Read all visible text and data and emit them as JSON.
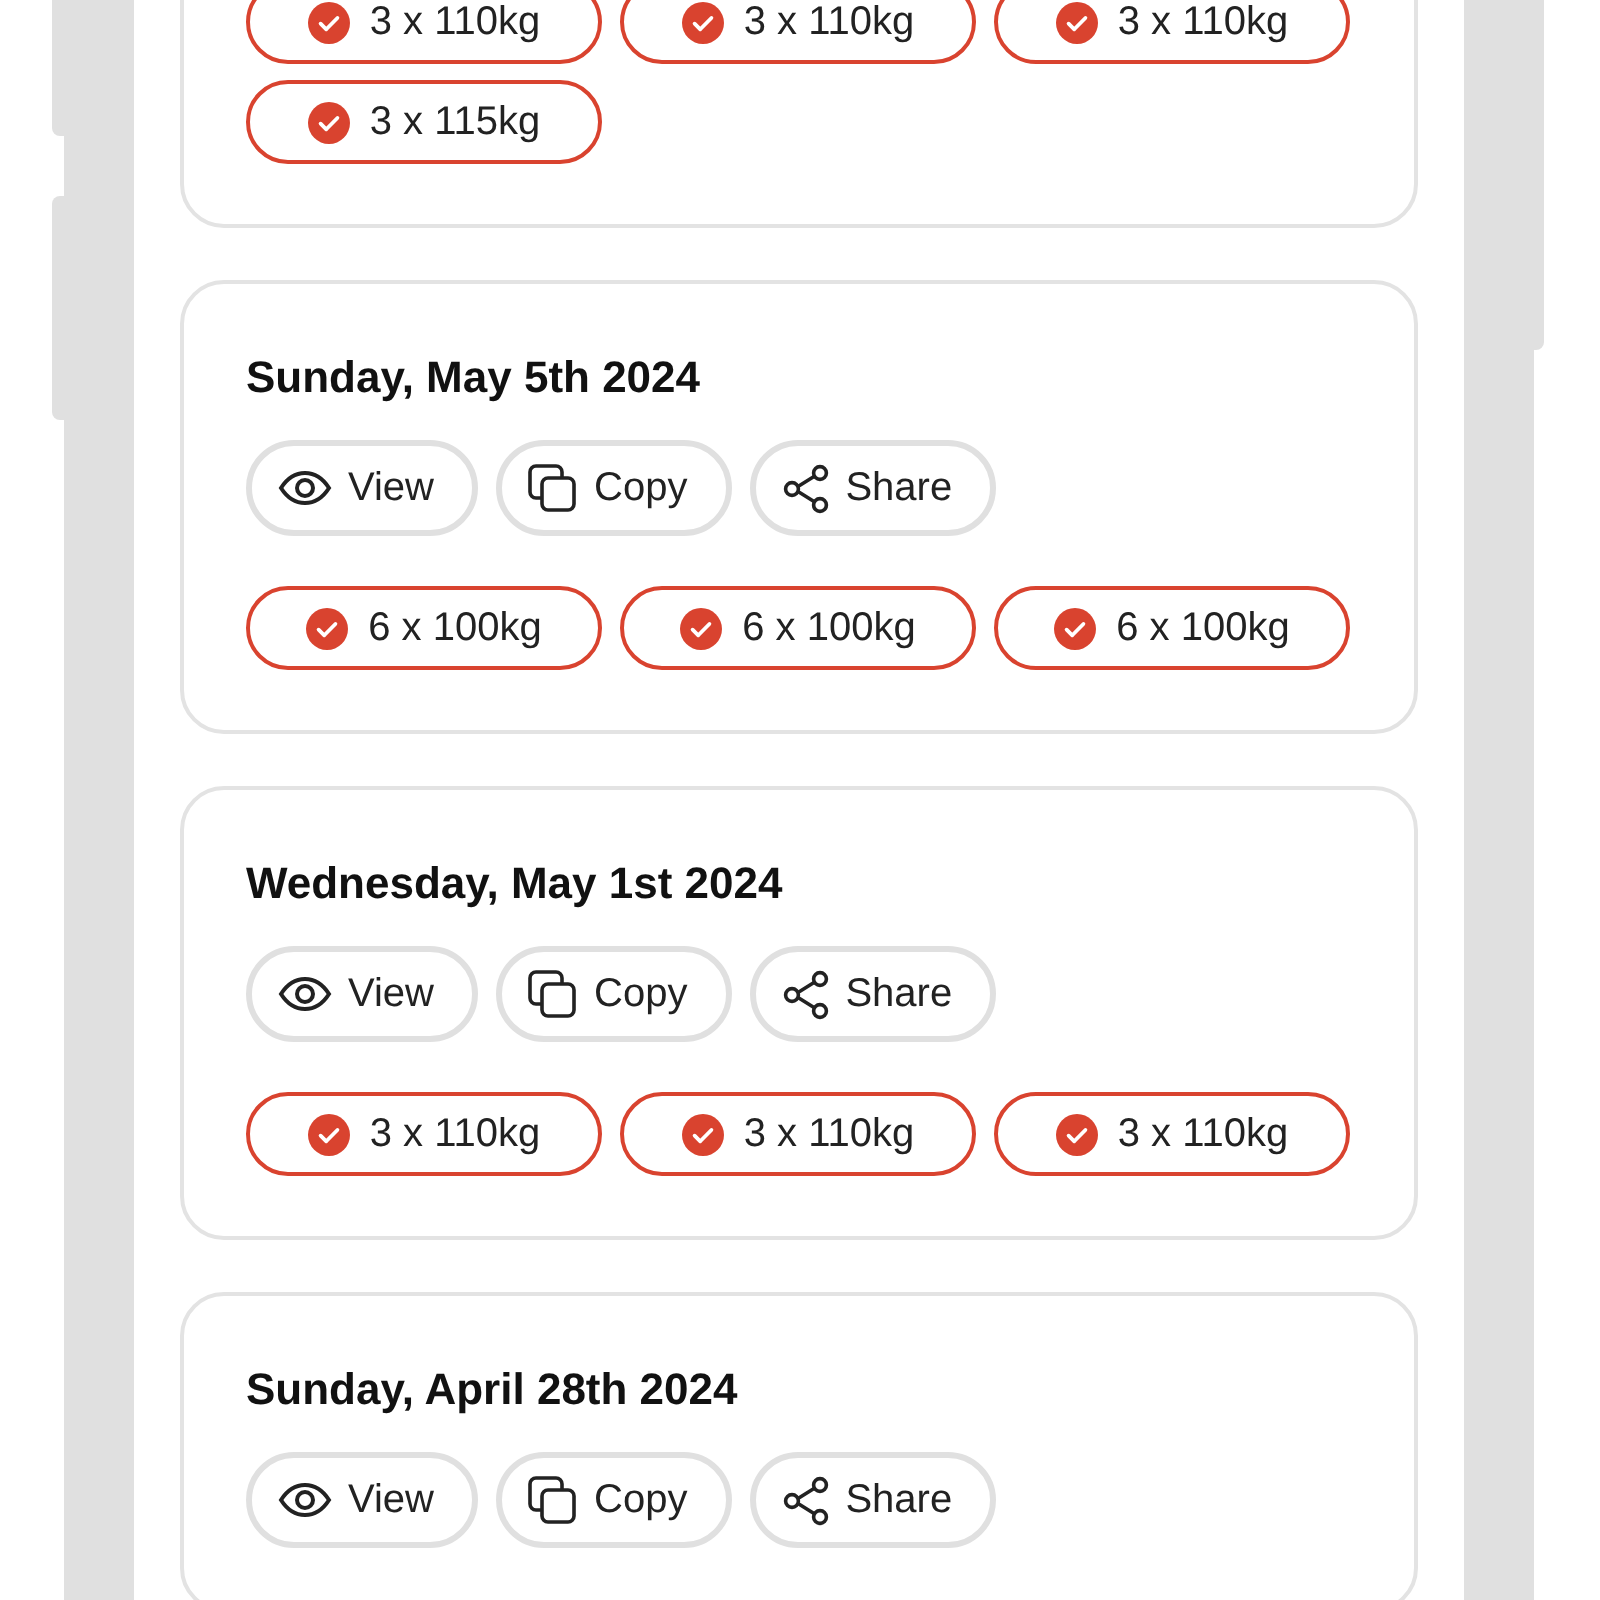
{
  "workouts": [
    {
      "sets": [
        {
          "label": "3 x 110kg",
          "done": true
        },
        {
          "label": "3 x 110kg",
          "done": true
        },
        {
          "label": "3 x 110kg",
          "done": true
        },
        {
          "label": "3 x 115kg",
          "done": true
        }
      ]
    },
    {
      "date": "Sunday, May 5th 2024",
      "actions": [
        {
          "kind": "view",
          "label": "View"
        },
        {
          "kind": "copy",
          "label": "Copy"
        },
        {
          "kind": "share",
          "label": "Share"
        }
      ],
      "sets": [
        {
          "label": "6 x 100kg",
          "done": true
        },
        {
          "label": "6 x 100kg",
          "done": true
        },
        {
          "label": "6 x 100kg",
          "done": true
        }
      ]
    },
    {
      "date": "Wednesday, May 1st 2024",
      "actions": [
        {
          "kind": "view",
          "label": "View"
        },
        {
          "kind": "copy",
          "label": "Copy"
        },
        {
          "kind": "share",
          "label": "Share"
        }
      ],
      "sets": [
        {
          "label": "3 x 110kg",
          "done": true
        },
        {
          "label": "3 x 110kg",
          "done": true
        },
        {
          "label": "3 x 110kg",
          "done": true
        }
      ]
    },
    {
      "date": "Sunday, April 28th 2024",
      "actions": [
        {
          "kind": "view",
          "label": "View"
        },
        {
          "kind": "copy",
          "label": "Copy"
        },
        {
          "kind": "share",
          "label": "Share"
        }
      ]
    }
  ]
}
